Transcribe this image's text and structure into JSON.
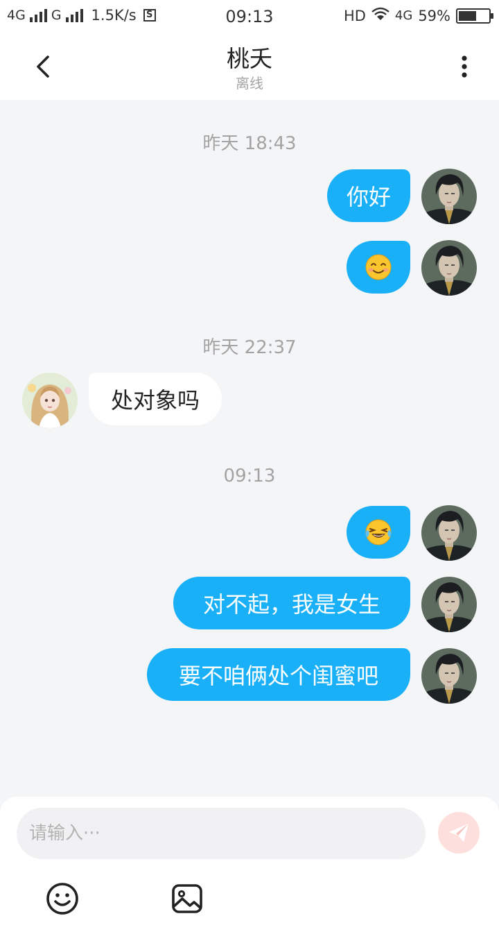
{
  "status_bar": {
    "network1": "4G",
    "network2": "G",
    "speed": "1.5K/s",
    "time": "09:13",
    "hd": "HD",
    "network3": "4G",
    "battery": "59%",
    "battery_level": 0.59
  },
  "header": {
    "title": "桃夭",
    "subtitle": "离线"
  },
  "chat": {
    "time_labels": [
      "昨天 18:43",
      "昨天 22:37",
      "09:13"
    ],
    "messages": [
      {
        "direction": "out",
        "type": "text",
        "text": "你好"
      },
      {
        "direction": "out",
        "type": "emoji",
        "icon": "smile-emoji-icon"
      },
      {
        "direction": "in",
        "type": "text",
        "text": "处对象吗"
      },
      {
        "direction": "out",
        "type": "emoji",
        "icon": "laugh-tears-emoji-icon"
      },
      {
        "direction": "out",
        "type": "text",
        "text": "对不起，我是女生"
      },
      {
        "direction": "out",
        "type": "text",
        "text": "要不咱俩处个闺蜜吧"
      }
    ]
  },
  "input": {
    "placeholder": "请输入···"
  },
  "colors": {
    "outgoing_bubble": "#1ab0f7",
    "incoming_bubble": "#ffffff",
    "background": "#f4f5f7",
    "send_button": "#fde0de"
  }
}
